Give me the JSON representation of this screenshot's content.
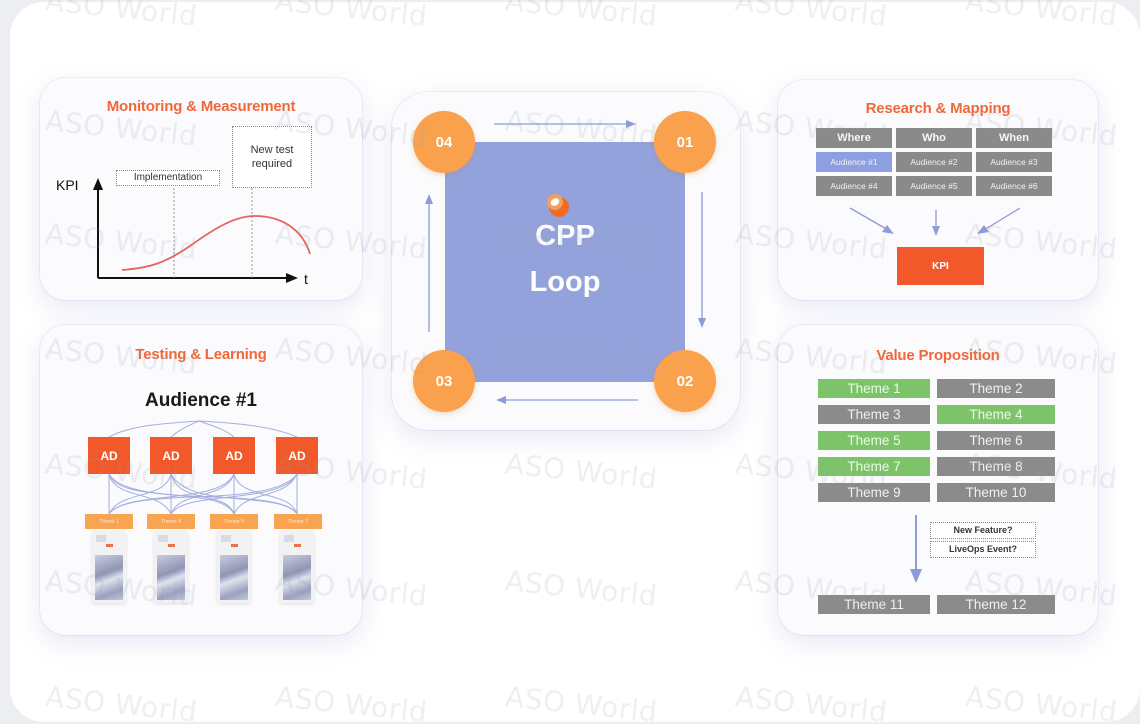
{
  "watermark": "ASO World",
  "colors": {
    "accent_orange": "#f0683a",
    "ad_orange": "#f1592a",
    "circle_orange": "#f9a14c",
    "loop_blue": "#94a2dc",
    "theme_green": "#7cc36a",
    "theme_gray": "#8b8b8b",
    "arrow_blue": "#8d9bd8"
  },
  "monitoring": {
    "title": "Monitoring & Measurement",
    "y_axis_label": "KPI",
    "x_axis_label": "t",
    "annotations": [
      "Implementation",
      "New test required"
    ]
  },
  "testing": {
    "title": "Testing & Learning",
    "audience": "Audience #1",
    "ads": [
      "AD",
      "AD",
      "AD",
      "AD"
    ],
    "themes": [
      "Theme 1",
      "Theme 4",
      "Theme 5",
      "Theme 7"
    ]
  },
  "cpp": {
    "title_line1": "CPP",
    "title_line2": "Loop",
    "steps": [
      "01",
      "02",
      "03",
      "04"
    ]
  },
  "research": {
    "title": "Research & Mapping",
    "columns": [
      "Where",
      "Who",
      "When"
    ],
    "rows": [
      [
        "Audience #1",
        "Audience #2",
        "Audience #3"
      ],
      [
        "Audience #4",
        "Audience #5",
        "Audience #6"
      ]
    ],
    "highlighted": "Audience #1",
    "target": "KPI"
  },
  "value": {
    "title": "Value Proposition",
    "themes": [
      {
        "label": "Theme 1",
        "status": "green"
      },
      {
        "label": "Theme 2",
        "status": "gray"
      },
      {
        "label": "Theme 3",
        "status": "gray"
      },
      {
        "label": "Theme 4",
        "status": "green"
      },
      {
        "label": "Theme 5",
        "status": "green"
      },
      {
        "label": "Theme 6",
        "status": "gray"
      },
      {
        "label": "Theme 7",
        "status": "green"
      },
      {
        "label": "Theme 8",
        "status": "gray"
      },
      {
        "label": "Theme 9",
        "status": "gray"
      },
      {
        "label": "Theme 10",
        "status": "gray"
      }
    ],
    "triggers": [
      "New Feature?",
      "LiveOps Event?"
    ],
    "new_themes": [
      "Theme 11",
      "Theme 12"
    ]
  }
}
